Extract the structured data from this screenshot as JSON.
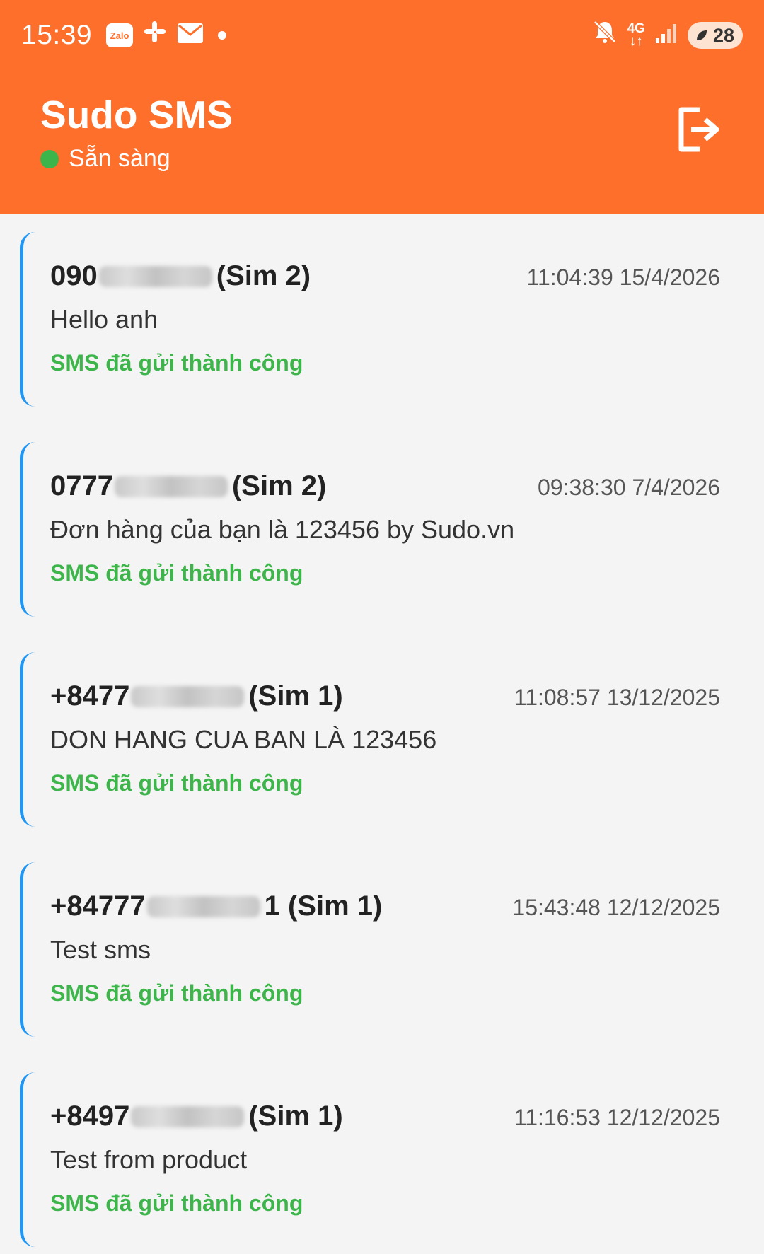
{
  "statusbar": {
    "time": "15:39",
    "zalo_label": "Zalo",
    "network": "4G",
    "battery": "28",
    "icons": [
      "zalo-icon",
      "slack-icon",
      "mail-icon",
      "notification-dot",
      "mute-icon",
      "network-4g-icon",
      "signal-icon",
      "battery-icon"
    ]
  },
  "header": {
    "title": "Sudo SMS",
    "status": "Sẵn sàng",
    "status_color": "#3cb54a",
    "background": "#fd6f2b",
    "logout_icon": "logout-icon"
  },
  "messages": [
    {
      "prefix": "090",
      "suffix": " (Sim 2)",
      "time": "11:04:39 15/4/2026",
      "text": "Hello anh",
      "status": "SMS đã gửi thành công"
    },
    {
      "prefix": "0777",
      "suffix": " (Sim 2)",
      "time": "09:38:30 7/4/2026",
      "text": "Đơn hàng của bạn là 123456 by Sudo.vn",
      "status": "SMS đã gửi thành công"
    },
    {
      "prefix": "+8477",
      "suffix": " (Sim 1)",
      "time": "11:08:57 13/12/2025",
      "text": "DON HANG CUA BAN LÀ 123456",
      "status": "SMS đã gửi thành công"
    },
    {
      "prefix": "+84777",
      "suffix": "1 (Sim 1)",
      "time": "15:43:48 12/12/2025",
      "text": "Test sms",
      "status": "SMS đã gửi thành công"
    },
    {
      "prefix": "+8497",
      "suffix": " (Sim 1)",
      "time": "11:16:53 12/12/2025",
      "text": "Test from product",
      "status": "SMS đã gửi thành công"
    }
  ],
  "colors": {
    "accent_border": "#2196f3",
    "success": "#3db54a"
  }
}
